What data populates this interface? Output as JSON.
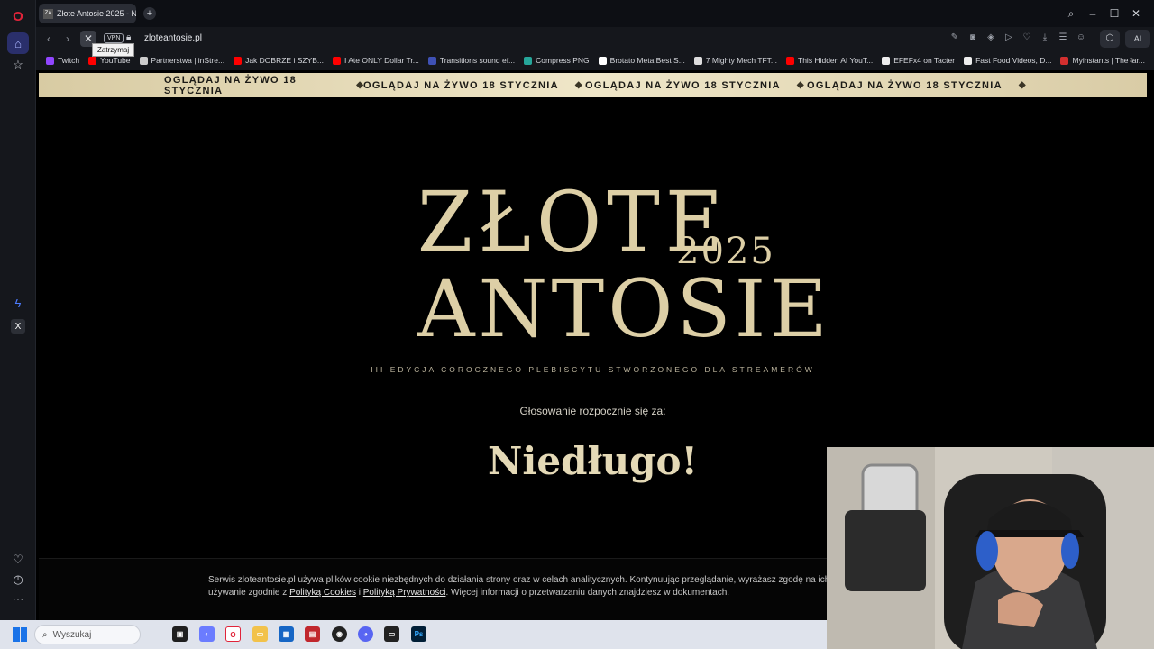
{
  "browser": {
    "tab_title": "Złote Antosie 2025 - Naj…",
    "tab_favicon": "ZA",
    "url": "zloteantosie.pl",
    "vpn_label": "VPN",
    "tooltip": "Zatrzymaj",
    "ai_label": "AI"
  },
  "bookmarks": [
    {
      "label": "Twitch",
      "color": "#9146ff"
    },
    {
      "label": "YouTube",
      "color": "#ff0000"
    },
    {
      "label": "Partnerstwa | inStre...",
      "color": "#cccccc"
    },
    {
      "label": "Jak DOBRZE i SZYB...",
      "color": "#ff0000"
    },
    {
      "label": "I Ate ONLY Dollar Tr...",
      "color": "#ff0000"
    },
    {
      "label": "Transitions sound ef...",
      "color": "#3f51b5"
    },
    {
      "label": "Compress PNG",
      "color": "#26a69a"
    },
    {
      "label": "Brotato Meta Best S...",
      "color": "#ffffff"
    },
    {
      "label": "7 Mighty Mech TFT...",
      "color": "#dddddd"
    },
    {
      "label": "This Hidden AI YouT...",
      "color": "#ff0000"
    },
    {
      "label": "EFEFx4 on Tacter",
      "color": "#eeeeee"
    },
    {
      "label": "Fast Food Videos, D...",
      "color": "#eeeeee"
    },
    {
      "label": "Myinstants | The lar...",
      "color": "#d32f2f"
    }
  ],
  "page": {
    "ticker_items": [
      "OGLĄDAJ NA ŻYWO 18 STYCZNIA",
      "OGLĄDAJ NA ŻYWO 18 STYCZNIA",
      "OGLĄDAJ NA ŻYWO 18 STYCZNIA",
      "OGLĄDAJ NA ŻYWO 18 STYCZNIA"
    ],
    "ticker_separator": "◆",
    "logo_line1": "ZŁOTE",
    "logo_year": "2025",
    "logo_line2": "ANTOSIE",
    "subtitle": "III EDYCJA COROCZNEGO PLEBISCYTU STWORZONEGO DLA STREAMERÓW",
    "countdown_label": "Głosowanie rozpocznie się za:",
    "countdown_value": "Niedługo!",
    "cookie_text_1": "Serwis zloteantosie.pl używa plików cookie niezbędnych do działania strony oraz w celach analitycznych. Kontynuując przeglądanie, wyrażasz zgodę na ich",
    "cookie_text_2": "używanie zgodnie z ",
    "cookie_link_1": "Polityką Cookies",
    "cookie_and": " i ",
    "cookie_link_2": "Polityką Prywatności",
    "cookie_text_3": ". Więcej informacji o przetwarzaniu danych znajdziesz w dokumentach."
  },
  "taskbar": {
    "search_placeholder": "Wyszukaj"
  },
  "colors": {
    "gold": "#ddcfa6",
    "ticker_bg": "#efe6c8",
    "opera_red": "#e0243a"
  }
}
